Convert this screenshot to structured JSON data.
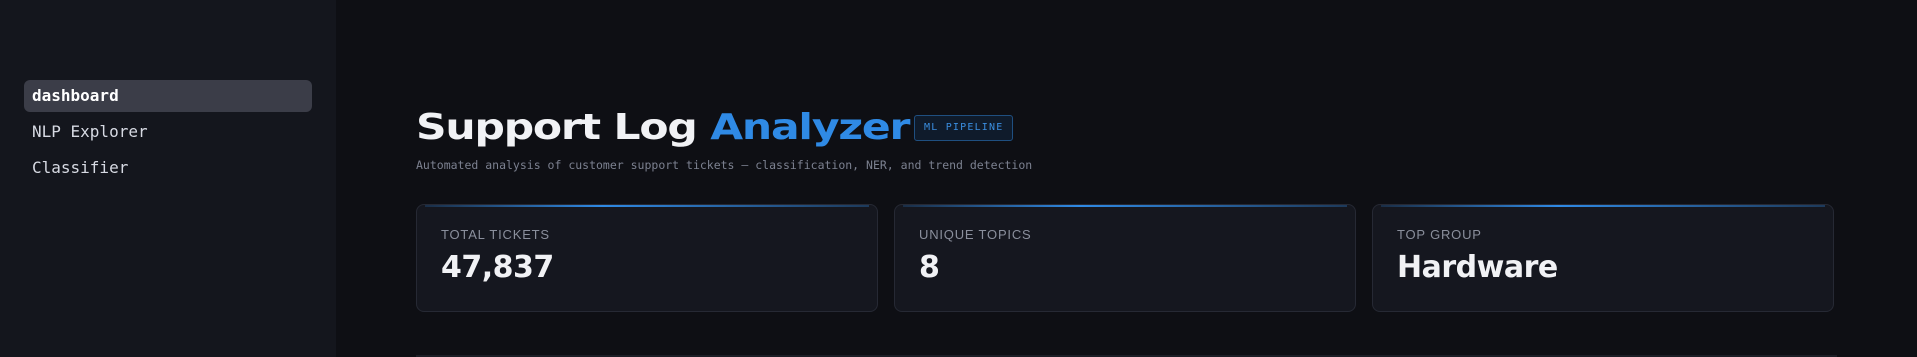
{
  "sidebar": {
    "items": [
      {
        "label": "dashboard",
        "active": true
      },
      {
        "label": "NLP Explorer",
        "active": false
      },
      {
        "label": "Classifier",
        "active": false
      }
    ]
  },
  "header": {
    "title_main": "Support Log ",
    "title_accent": "Analyzer",
    "badge": "ML PIPELINE",
    "subtitle": "Automated analysis of customer support tickets — classification, NER, and trend detection"
  },
  "stats": [
    {
      "label": "TOTAL TICKETS",
      "value": "47,837"
    },
    {
      "label": "UNIQUE TOPICS",
      "value": "8"
    },
    {
      "label": "TOP GROUP",
      "value": "Hardware"
    }
  ],
  "colors": {
    "background": "#0e0f14",
    "sidebar": "#14161d",
    "accent": "#2f8ae5",
    "active_nav": "#3b3d48"
  }
}
